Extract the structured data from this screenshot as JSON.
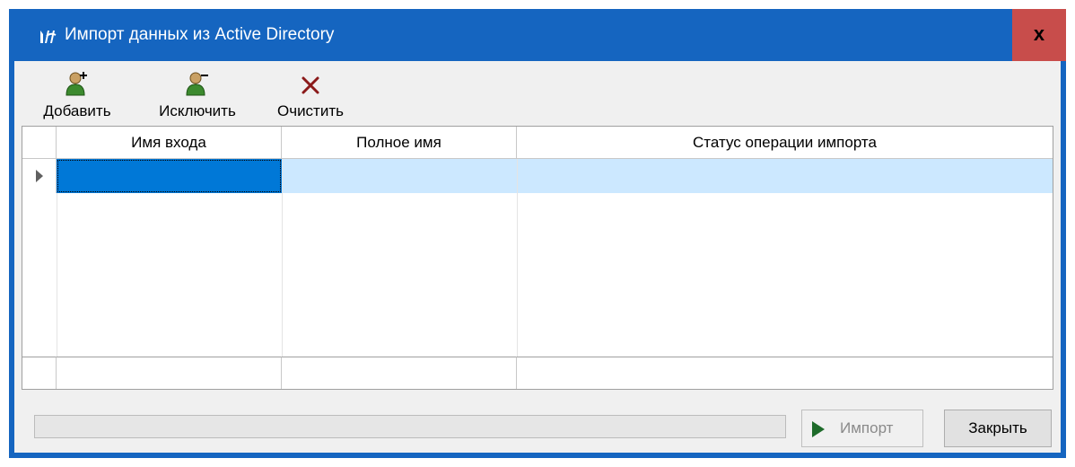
{
  "window": {
    "title": "Импорт данных из Active Directory",
    "close_label": "x"
  },
  "toolbar": {
    "add_label": "Добавить",
    "exclude_label": "Исключить",
    "clear_label": "Очистить"
  },
  "grid": {
    "columns": [
      "Имя входа",
      "Полное имя",
      "Статус операции импорта"
    ],
    "rows": [
      {
        "login": "",
        "full_name": "",
        "status": ""
      }
    ],
    "footer": [
      "",
      "",
      ""
    ]
  },
  "progress": {
    "value": 0
  },
  "buttons": {
    "import_label": "Импорт",
    "close_label": "Закрыть"
  },
  "colors": {
    "titlebar": "#1565c0",
    "close": "#c84d4b",
    "selection": "#0078d7",
    "row_highlight": "#cce8ff",
    "play_icon": "#1e6b2a"
  }
}
